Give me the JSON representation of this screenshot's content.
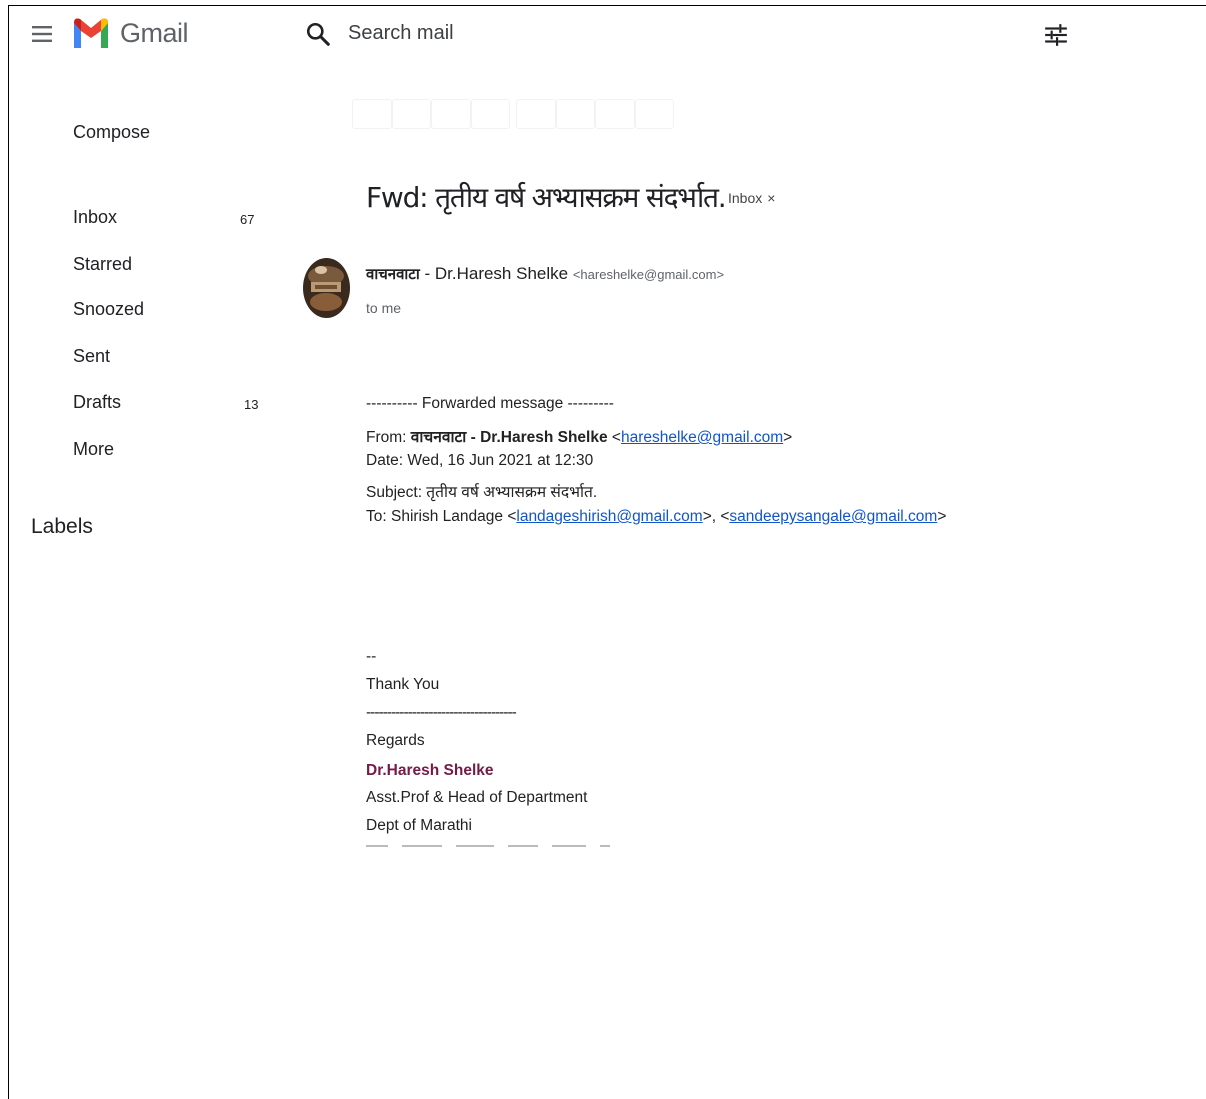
{
  "header": {
    "logo_text": "Gmail",
    "search_placeholder": "Search mail"
  },
  "sidebar": {
    "compose_label": "Compose",
    "items": [
      {
        "label": "Inbox",
        "count": "67"
      },
      {
        "label": "Starred",
        "count": ""
      },
      {
        "label": "Snoozed",
        "count": ""
      },
      {
        "label": "Sent",
        "count": ""
      },
      {
        "label": "Drafts",
        "count": "13"
      },
      {
        "label": "More",
        "count": ""
      }
    ],
    "labels_heading": "Labels"
  },
  "email": {
    "subject": "Fwd: तृतीय वर्ष अभ्यासक्रम संदर्भात.",
    "label_chip": "Inbox",
    "label_chip_close": "×",
    "sender_name": "वाचनवाटा",
    "sender_sep": " - ",
    "sender_person": "Dr.Haresh Shelke",
    "sender_email": "<hareshelke@gmail.com>",
    "to_line": "to me",
    "forwarded_header": "---------- Forwarded message ---------",
    "from_label": "From: ",
    "from_name": "वाचनवाटा - Dr.Haresh Shelke",
    "from_email": "hareshelke@gmail.com",
    "date_line": "Date: Wed, 16 Jun 2021 at 12:30",
    "subject_line": "Subject: तृतीय वर्ष अभ्यासक्रम संदर्भात.",
    "to_label": "To: Shirish Landage <",
    "to_email1": "landageshirish@gmail.com",
    "to_sep": ">, <",
    "to_email2": "sandeepysangale@gmail.com",
    "to_end": ">",
    "sig_dash": "--",
    "thank_you": "Thank You",
    "sig_rule": "------------------------------------",
    "regards": "Regards",
    "sig_name": "Dr.Haresh Shelke",
    "sig_title": "Asst.Prof & Head of Department",
    "sig_dept": "Dept of Marathi"
  },
  "colors": {
    "link": "#1155cc",
    "signature_name": "#741b47",
    "gmail_red": "#ea4335",
    "gmail_blue": "#4285f4",
    "gmail_green": "#34a853",
    "gmail_yellow": "#fbbc04"
  },
  "icons": [
    "menu-icon",
    "gmail-logo",
    "search-icon",
    "tune-icon"
  ]
}
